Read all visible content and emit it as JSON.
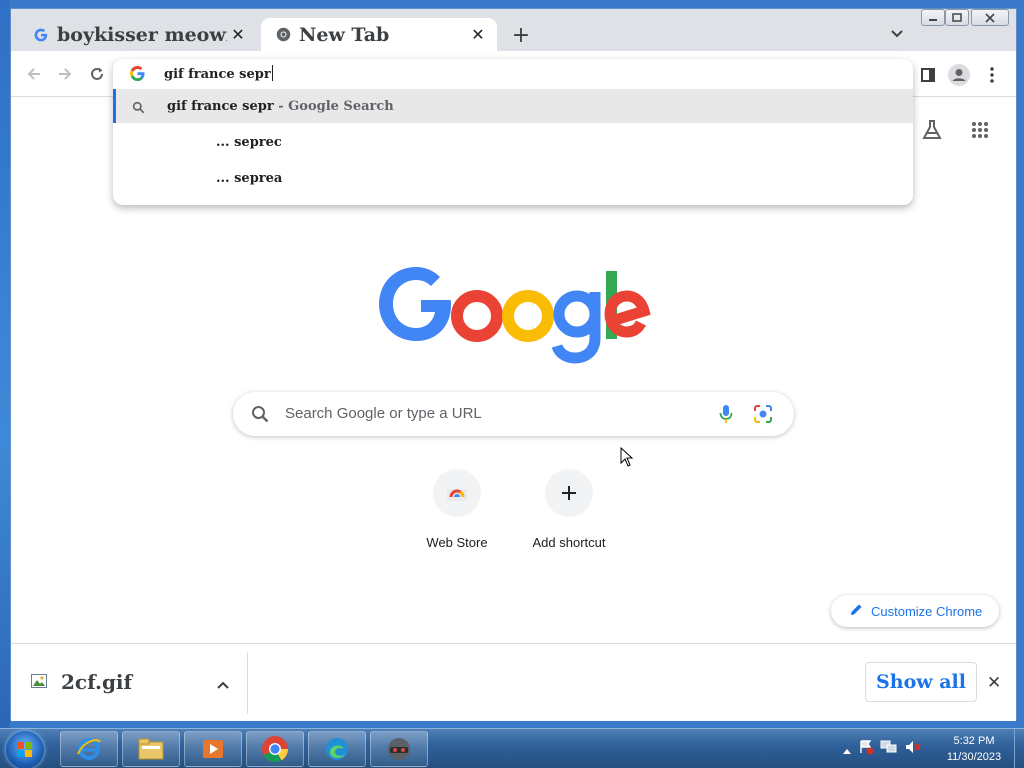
{
  "browser": {
    "tabs": [
      {
        "title": "boykisser meowin",
        "close": "✕",
        "favicon": "google-g-icon"
      },
      {
        "title": "New Tab",
        "close": "✕",
        "favicon": "chrome-icon"
      }
    ],
    "new_tab": "+",
    "window_controls": [
      "minimize-icon",
      "maximize-icon",
      "close-icon"
    ]
  },
  "omnibox": {
    "query": "gif france sepr",
    "suggestions": [
      {
        "bold": "gif france sepr",
        "suffix": " - Google Search",
        "icon": "search-icon"
      },
      {
        "bold": "... seprec",
        "suffix": "",
        "icon": ""
      },
      {
        "bold": "... seprea",
        "suffix": "",
        "icon": ""
      }
    ]
  },
  "ntp": {
    "search_placeholder": "Search Google or type a URL",
    "shortcuts": [
      {
        "label": "Web Store",
        "icon": "webstore-icon"
      },
      {
        "label": "Add shortcut",
        "icon": "plus-icon"
      }
    ],
    "customize_label": "Customize Chrome",
    "google_colors": [
      "#4285F4",
      "#EA4335",
      "#FBBC05",
      "#34A853"
    ]
  },
  "downloads": {
    "file_name": "2cf.gif",
    "show_all": "Show all",
    "close": "✕"
  },
  "taskbar": {
    "time": "5:32 PM",
    "date": "11/30/2023",
    "apps": [
      "internet-explorer-icon",
      "file-explorer-icon",
      "media-player-icon",
      "chrome-icon",
      "edge-icon",
      "game-app-icon"
    ]
  }
}
